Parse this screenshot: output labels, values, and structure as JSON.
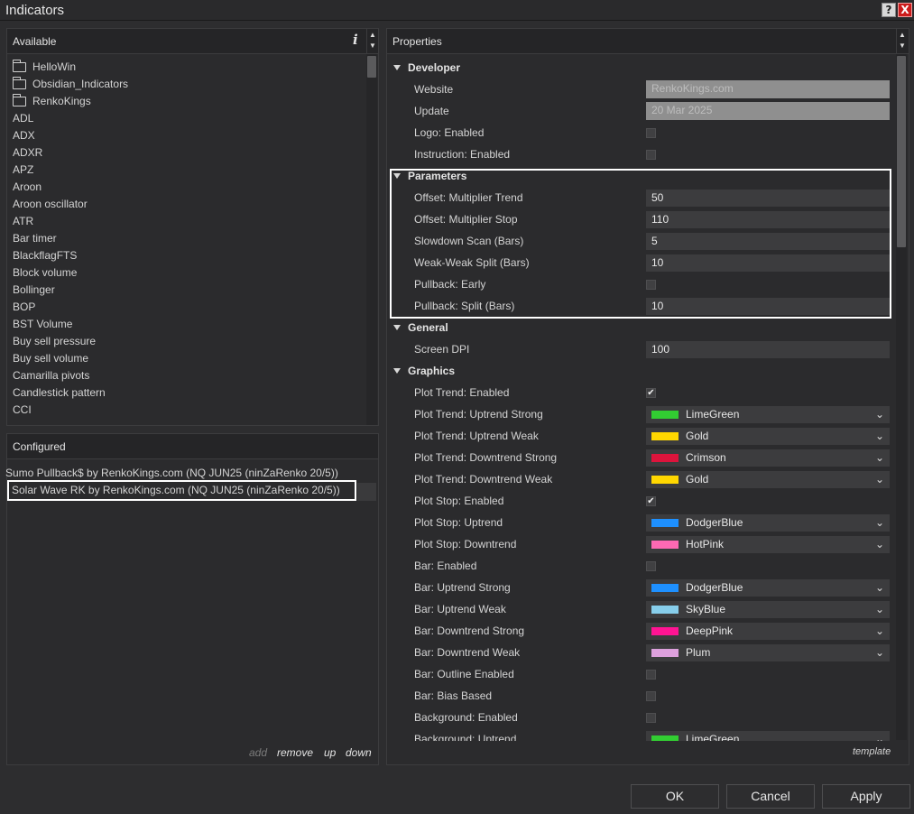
{
  "window": {
    "title": "Indicators",
    "help_label": "?",
    "close_label": "X"
  },
  "available": {
    "header": "Available",
    "info_label": "i",
    "items": [
      {
        "label": "HelloWin",
        "folder": true
      },
      {
        "label": "Obsidian_Indicators",
        "folder": true
      },
      {
        "label": "RenkoKings",
        "folder": true
      },
      {
        "label": "ADL"
      },
      {
        "label": "ADX"
      },
      {
        "label": "ADXR"
      },
      {
        "label": "APZ"
      },
      {
        "label": "Aroon"
      },
      {
        "label": "Aroon oscillator"
      },
      {
        "label": "ATR"
      },
      {
        "label": "Bar timer"
      },
      {
        "label": "BlackflagFTS"
      },
      {
        "label": "Block volume"
      },
      {
        "label": "Bollinger"
      },
      {
        "label": "BOP"
      },
      {
        "label": "BST Volume"
      },
      {
        "label": "Buy sell pressure"
      },
      {
        "label": "Buy sell volume"
      },
      {
        "label": "Camarilla pivots"
      },
      {
        "label": "Candlestick pattern"
      },
      {
        "label": "CCI"
      }
    ]
  },
  "configured": {
    "header": "Configured",
    "items": [
      "Sumo Pullback$ by RenkoKings.com (NQ JUN25 (ninZaRenko 20/5))",
      "Solar Wave RK by RenkoKings.com (NQ JUN25 (ninZaRenko 20/5))"
    ],
    "actions": {
      "add": "add",
      "remove": "remove",
      "up": "up",
      "down": "down"
    }
  },
  "properties": {
    "header": "Properties",
    "sections": [
      {
        "name": "Developer",
        "rows": [
          {
            "label": "Website",
            "type": "readonly",
            "value": "RenkoKings.com"
          },
          {
            "label": "Update",
            "type": "readonly",
            "value": "20 Mar 2025"
          },
          {
            "label": "Logo: Enabled",
            "type": "checkbox",
            "checked": false
          },
          {
            "label": "Instruction: Enabled",
            "type": "checkbox",
            "checked": false
          }
        ]
      },
      {
        "name": "Parameters",
        "rows": [
          {
            "label": "Offset: Multiplier Trend",
            "type": "text",
            "value": "50"
          },
          {
            "label": "Offset: Multiplier Stop",
            "type": "text",
            "value": "110"
          },
          {
            "label": "Slowdown Scan (Bars)",
            "type": "text",
            "value": "5"
          },
          {
            "label": "Weak-Weak Split (Bars)",
            "type": "text",
            "value": "10"
          },
          {
            "label": "Pullback: Early",
            "type": "checkbox",
            "checked": false
          },
          {
            "label": "Pullback: Split (Bars)",
            "type": "text",
            "value": "10"
          }
        ]
      },
      {
        "name": "General",
        "rows": [
          {
            "label": "Screen DPI",
            "type": "text",
            "value": "100"
          }
        ]
      },
      {
        "name": "Graphics",
        "rows": [
          {
            "label": "Plot Trend: Enabled",
            "type": "checkbox",
            "checked": true
          },
          {
            "label": "Plot Trend: Uptrend Strong",
            "type": "color",
            "value": "LimeGreen",
            "color": "#32cd32"
          },
          {
            "label": "Plot Trend: Uptrend Weak",
            "type": "color",
            "value": "Gold",
            "color": "#ffd700"
          },
          {
            "label": "Plot Trend: Downtrend Strong",
            "type": "color",
            "value": "Crimson",
            "color": "#dc143c"
          },
          {
            "label": "Plot Trend: Downtrend Weak",
            "type": "color",
            "value": "Gold",
            "color": "#ffd700"
          },
          {
            "label": "Plot Stop: Enabled",
            "type": "checkbox",
            "checked": true
          },
          {
            "label": "Plot Stop: Uptrend",
            "type": "color",
            "value": "DodgerBlue",
            "color": "#1e90ff"
          },
          {
            "label": "Plot Stop: Downtrend",
            "type": "color",
            "value": "HotPink",
            "color": "#ff69b4"
          },
          {
            "label": "Bar: Enabled",
            "type": "checkbox",
            "checked": false
          },
          {
            "label": "Bar: Uptrend Strong",
            "type": "color",
            "value": "DodgerBlue",
            "color": "#1e90ff"
          },
          {
            "label": "Bar: Uptrend Weak",
            "type": "color",
            "value": "SkyBlue",
            "color": "#87ceeb"
          },
          {
            "label": "Bar: Downtrend Strong",
            "type": "color",
            "value": "DeepPink",
            "color": "#ff1493"
          },
          {
            "label": "Bar: Downtrend Weak",
            "type": "color",
            "value": "Plum",
            "color": "#dda0dd"
          },
          {
            "label": "Bar: Outline Enabled",
            "type": "checkbox",
            "checked": false
          },
          {
            "label": "Bar: Bias Based",
            "type": "checkbox",
            "checked": false
          },
          {
            "label": "Background: Enabled",
            "type": "checkbox",
            "checked": false
          },
          {
            "label": "Background: Uptrend",
            "type": "color",
            "value": "LimeGreen",
            "color": "#32cd32"
          }
        ]
      }
    ],
    "template_label": "template"
  },
  "buttons": {
    "ok": "OK",
    "cancel": "Cancel",
    "apply": "Apply"
  }
}
